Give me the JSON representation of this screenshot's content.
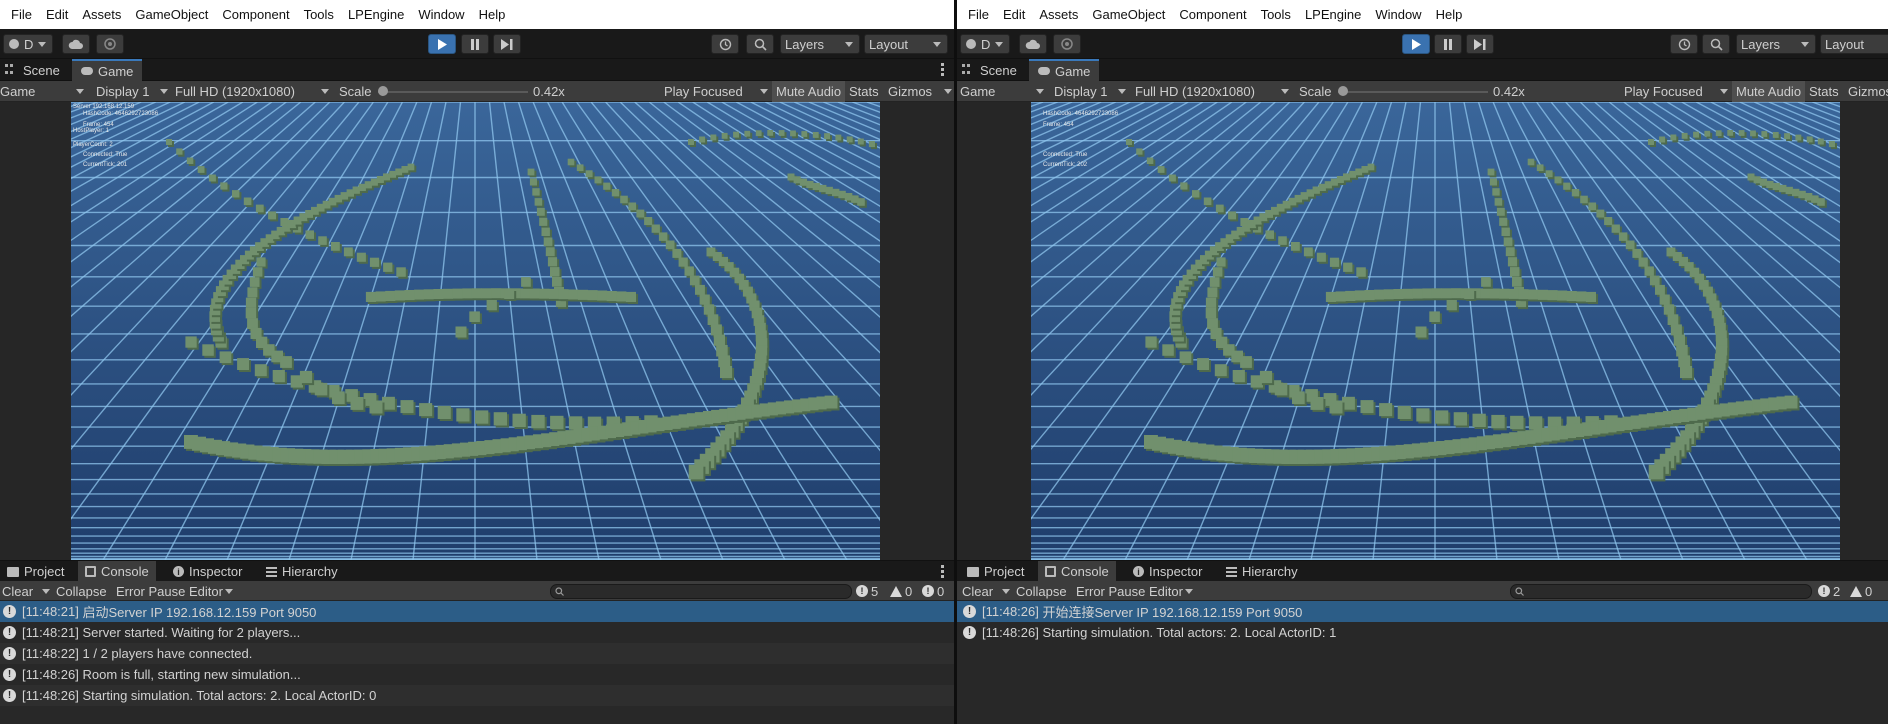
{
  "menu": [
    "File",
    "Edit",
    "Assets",
    "GameObject",
    "Component",
    "Tools",
    "LPEngine",
    "Window",
    "Help"
  ],
  "toolbar": {
    "account_label": "D",
    "layers_label": "Layers",
    "layout_label": "Layout"
  },
  "view_tabs": {
    "scene": "Scene",
    "game": "Game"
  },
  "game_controls": {
    "mode": "Game",
    "display": "Display 1",
    "resolution": "Full HD (1920x1080)",
    "scale_label": "Scale",
    "scale_value": "0.42x",
    "play_focused": "Play Focused",
    "mute_audio": "Mute Audio",
    "stats": "Stats",
    "gizmos": "Gizmos"
  },
  "panel_tabs": {
    "project": "Project",
    "console": "Console",
    "inspector": "Inspector",
    "hierarchy": "Hierarchy"
  },
  "console_toolbar": {
    "clear": "Clear",
    "collapse": "Collapse",
    "error_pause": "Error Pause",
    "editor": "Editor"
  },
  "colors": {
    "accent": "#3a79bb",
    "selected_row": "#2c5d87",
    "sky": "#2c4f80",
    "grid_line": "#8fc6ee",
    "block": "#71906d"
  },
  "icons": [
    "menu-icon",
    "account-icon",
    "cloud-icon",
    "collab-icon",
    "play-icon",
    "pause-icon",
    "step-icon",
    "history-icon",
    "search-icon",
    "scene-icon",
    "game-icon",
    "project-icon",
    "console-icon",
    "inspector-icon",
    "hierarchy-icon",
    "info-icon",
    "warning-icon",
    "error-icon"
  ],
  "left": {
    "overlay": {
      "line1": "Server 192.168.12.159",
      "line2": "HashCode: 4646292723086",
      "line3": "Frame: 454",
      "line4": "HostPlayer: 1",
      "line5": "PlayerCount: 2",
      "line6": "Connected: True",
      "line7": "CurrentTick: 201"
    },
    "counts": {
      "log": "5",
      "warn": "0",
      "error": "0"
    },
    "logs": [
      {
        "time": "[11:48:21]",
        "text": "启动Server  IP 192.168.12.159 Port 9050"
      },
      {
        "time": "[11:48:21]",
        "text": "Server started. Waiting for 2 players..."
      },
      {
        "time": "[11:48:22]",
        "text": "1 / 2 players have connected."
      },
      {
        "time": "[11:48:26]",
        "text": "Room is full, starting new simulation..."
      },
      {
        "time": "[11:48:26]",
        "text": "Starting simulation. Total actors: 2. Local ActorID: 0"
      }
    ]
  },
  "right": {
    "overlay": {
      "line1": "HashCode: 4646292723086",
      "line2": "Frame: 454",
      "line3": "Connected: True",
      "line4": "CurrentTick: 202"
    },
    "counts": {
      "log": "2",
      "warn": "0"
    },
    "logs": [
      {
        "time": "[11:48:26]",
        "text": "开始连接Server IP 192.168.12.159 Port 9050"
      },
      {
        "time": "[11:48:26]",
        "text": "Starting simulation. Total actors: 2. Local ActorID: 1"
      }
    ]
  }
}
